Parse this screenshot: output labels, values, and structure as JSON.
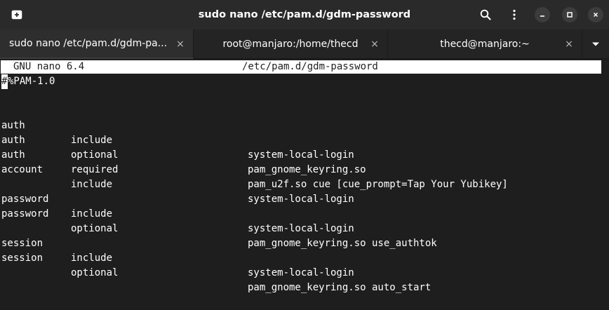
{
  "window": {
    "title": "sudo nano /etc/pam.d/gdm-password"
  },
  "tabs": [
    {
      "label": "sudo nano /etc/pam.d/gdm-pa...",
      "active": true
    },
    {
      "label": "root@manjaro:/home/thecd",
      "active": false
    },
    {
      "label": "thecd@manjaro:~",
      "active": false
    }
  ],
  "icons": {
    "new_tab": "new-tab-icon",
    "search": "search-icon",
    "menu": "kebab-menu-icon",
    "minimize": "minimize-icon",
    "maximize": "maximize-icon",
    "close": "close-icon",
    "tab_close": "×",
    "tab_overflow": "chevron-down-icon"
  },
  "nano": {
    "version": "GNU nano 6.4",
    "filename": "/etc/pam.d/gdm-password"
  },
  "file": {
    "first_line_cursor_char": "#",
    "first_line_rest": "%PAM-1.0",
    "lines": [
      {
        "type": "auth",
        "control": "include",
        "module": "system-local-login"
      },
      {
        "type": "auth",
        "control": "optional",
        "module": "pam_gnome_keyring.so"
      },
      {
        "type": "auth",
        "control": "required",
        "module": "pam_u2f.so cue [cue_prompt=Tap Your Yubikey]"
      },
      {
        "type": "account",
        "control": "include",
        "module": "system-local-login"
      },
      {
        "type": "password",
        "control": "include",
        "module": "system-local-login"
      },
      {
        "type": "password",
        "control": "optional",
        "module": "pam_gnome_keyring.so use_authtok"
      },
      {
        "type": "session",
        "control": "include",
        "module": "system-local-login"
      },
      {
        "type": "session",
        "control": "optional",
        "module": "pam_gnome_keyring.so auto_start"
      }
    ]
  },
  "colors": {
    "background": "#1e1e1e",
    "headerbar": "#2a2a2a",
    "text": "#ffffff"
  }
}
